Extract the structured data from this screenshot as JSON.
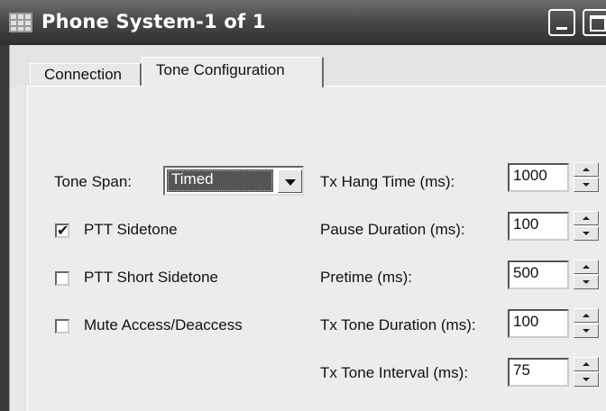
{
  "window": {
    "title": "Phone System-1 of 1",
    "icon": "grid-app-icon",
    "controls": [
      "minimize-icon",
      "maximize-icon"
    ],
    "colors": {
      "titlebar": "#3c3c3c",
      "panel": "#ececec",
      "selected_combo": "#555555"
    }
  },
  "tabs": [
    {
      "label": "Connection",
      "selected": false
    },
    {
      "label": "Tone Configuration",
      "selected": true
    }
  ],
  "tone_span": {
    "label": "Tone Span:",
    "value": "Timed"
  },
  "checkboxes": [
    {
      "label": "PTT Sidetone",
      "checked": true,
      "mark": "✔"
    },
    {
      "label": "PTT Short Sidetone",
      "checked": false,
      "mark": ""
    },
    {
      "label": "Mute Access/Deaccess",
      "checked": false,
      "mark": ""
    }
  ],
  "fields": [
    {
      "label": "Tx Hang Time (ms):",
      "value": "1000"
    },
    {
      "label": "Pause Duration (ms):",
      "value": "100"
    },
    {
      "label": "Pretime (ms):",
      "value": "500"
    },
    {
      "label": "Tx Tone Duration (ms):",
      "value": "100"
    },
    {
      "label": "Tx Tone Interval (ms):",
      "value": "75"
    }
  ]
}
